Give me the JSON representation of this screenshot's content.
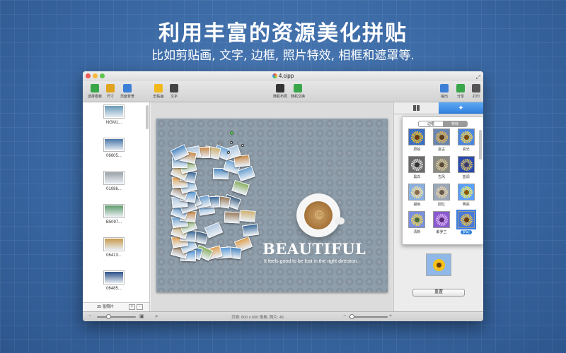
{
  "headline": "利用丰富的资源美化拼贴",
  "subheadline": "比如剪贴画, 文字, 边框, 照片特效, 相框和遮罩等.",
  "window": {
    "title": "4.cipp"
  },
  "toolbar": {
    "items": [
      {
        "label": "选择模板",
        "icon": "template-icon",
        "color": "#3aa64a"
      },
      {
        "label": "尺寸",
        "icon": "ruler-icon",
        "color": "#e0a41e"
      },
      {
        "label": "页面背景",
        "icon": "background-icon",
        "color": "#3d7fd6"
      },
      {
        "label": "剪贴画",
        "icon": "star-icon",
        "color": "#f0b81a"
      },
      {
        "label": "文字",
        "icon": "text-icon",
        "color": "#444444"
      },
      {
        "label": "随机布局",
        "icon": "dice-icon",
        "color": "#333333"
      },
      {
        "label": "随机交换",
        "icon": "shuffle-icon",
        "color": "#3aa64a"
      },
      {
        "label": "输出",
        "icon": "export-icon",
        "color": "#3d7fd6"
      },
      {
        "label": "分享",
        "icon": "share-icon",
        "color": "#3aa64a"
      },
      {
        "label": "打印",
        "icon": "print-icon",
        "color": "#555555"
      }
    ]
  },
  "sidebar": {
    "photos": [
      {
        "label": "NGM1...",
        "color": "#6a9ab8"
      },
      {
        "label": "06605...",
        "color": "#4b78a8"
      },
      {
        "label": "01086...",
        "color": "#9aa2a8"
      },
      {
        "label": "B5097...",
        "color": "#5f9a6a"
      },
      {
        "label": "06413...",
        "color": "#c89a4a"
      },
      {
        "label": "06485...",
        "color": "#2a4e88"
      }
    ],
    "photo_count": "35 张照片",
    "add_label": "+",
    "remove_label": "-"
  },
  "canvas": {
    "headline_text": "BEAUTIFUL",
    "tagline": "It feels good to be lost in the right direction."
  },
  "inspector": {
    "segments": [
      "边框",
      "特效"
    ],
    "active_segment": 1,
    "filters": [
      {
        "label": "原始",
        "petal": "#f6c21a",
        "center": "#6a3a0a",
        "bg": "#3a6fc4"
      },
      {
        "label": "复古",
        "petal": "#e8b550",
        "center": "#5a3a1a",
        "bg": "#6a86b0"
      },
      {
        "label": "高光",
        "petal": "#ffd84a",
        "center": "#7a4a0a",
        "bg": "#4a86e0"
      },
      {
        "label": "黑白",
        "petal": "#d8d8d8",
        "center": "#333333",
        "bg": "#6a6a6a"
      },
      {
        "label": "古风",
        "petal": "#d8c79a",
        "center": "#5a4a3a",
        "bg": "#8a8a80"
      },
      {
        "label": "蓝调",
        "petal": "#e0c45a",
        "center": "#3a3a6a",
        "bg": "#2a4ab0"
      },
      {
        "label": "褪色",
        "petal": "#f8e29a",
        "center": "#8a6a4a",
        "bg": "#8ab0e0"
      },
      {
        "label": "回忆",
        "petal": "#e8d0a8",
        "center": "#6a5a4a",
        "bg": "#9aa8b8"
      },
      {
        "label": "明亮",
        "petal": "#fff05a",
        "center": "#8a5a0a",
        "bg": "#5aa0ff"
      },
      {
        "label": "清新",
        "petal": "#f0d84a",
        "center": "#4a6a3a",
        "bg": "#7a90e0"
      },
      {
        "label": "紫罗兰",
        "petal": "#d8b0f0",
        "center": "#5a2a7a",
        "bg": "#8a5ad0"
      },
      {
        "label": "梦幻",
        "petal": "#f4c840",
        "center": "#6a3a0a",
        "bg": "#4a7ad8"
      }
    ],
    "selected_filter": 11,
    "reset_label": "重置"
  },
  "statusbar": {
    "info": "页面: 800 x 600 像素, 照片: 46",
    "zoom_out_label": "−",
    "zoom_in_label": "+"
  }
}
